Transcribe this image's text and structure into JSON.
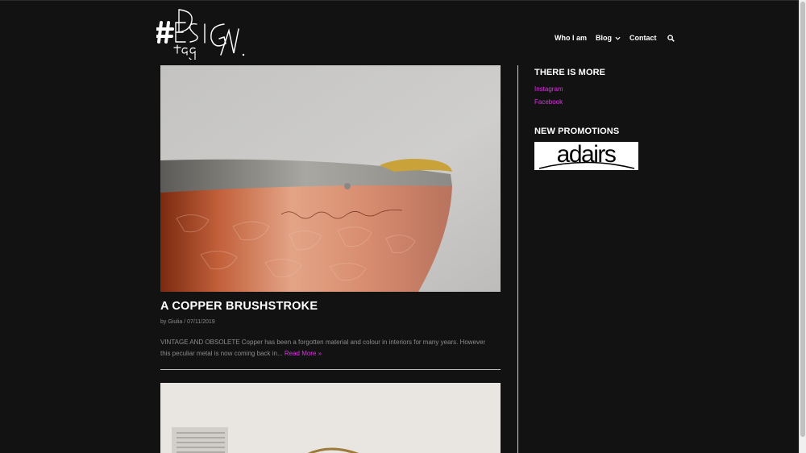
{
  "logo": {
    "alt": "#Design tag logo"
  },
  "nav": {
    "items": [
      {
        "label": "Who I am"
      },
      {
        "label": "Blog"
      },
      {
        "label": "Contact"
      }
    ]
  },
  "post": {
    "title": "A COPPER BRUSHSTROKE",
    "meta_by": "by",
    "author": "Giulia",
    "meta_sep": "/",
    "date": "07/11/2019",
    "excerpt_line1": "VINTAGE AND OBSOLETE Copper has been a forgotten material and colour in interiors for many years. However",
    "excerpt_line2": "this peculiar metal is now coming back in...",
    "read_more": "Read More »"
  },
  "sidebar": {
    "widget1_title": "THERE IS MORE",
    "links": [
      {
        "label": "Instagram"
      },
      {
        "label": "Facebook"
      }
    ],
    "widget2_title": "NEW PROMOTIONS",
    "ad_text": "adairs"
  },
  "colors": {
    "background": "#121212",
    "accent": "#e12de8",
    "text": "#ffffff",
    "muted": "#8c8c8c"
  }
}
